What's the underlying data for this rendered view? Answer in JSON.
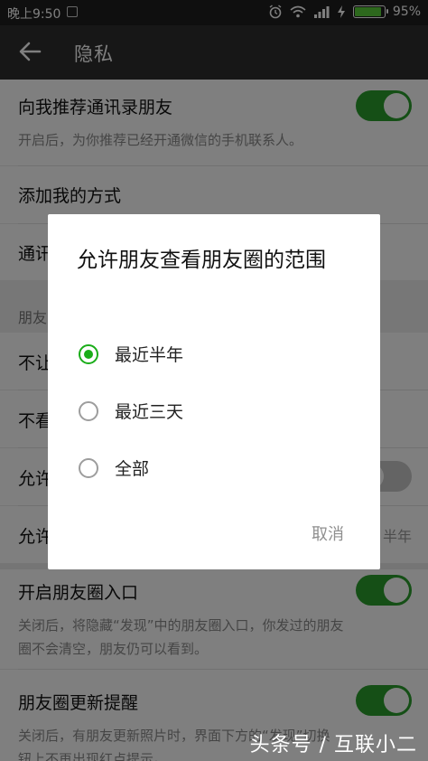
{
  "status_bar": {
    "time": "晚上9:50",
    "battery": "95%",
    "battery_level": 0.95
  },
  "header": {
    "title": "隐私",
    "back_icon": "back-arrow-icon"
  },
  "settings": {
    "recommend_contacts": {
      "label": "向我推荐通讯录朋友",
      "desc": "开启后，为你推荐已经开通微信的手机联系人。",
      "toggle_on": true
    },
    "add_me_methods": {
      "label": "添加我的方式"
    },
    "contacts_partial": {
      "label": "通讯"
    },
    "moments_section": {
      "label": "朋友"
    },
    "no_let_partial": {
      "label": "不让"
    },
    "no_see_partial": {
      "label": "不看"
    },
    "allow_partial_1": {
      "label": "允许",
      "toggle_on": false
    },
    "allow_partial_2": {
      "label": "允许",
      "value": "半年"
    },
    "moments_entry": {
      "label": "开启朋友圈入口",
      "desc_line1": "关闭后，将隐藏“发现”中的朋友圈入口，你发过的朋友",
      "desc_line2": "圈不会清空，朋友仍可以看到。",
      "toggle_on": true
    },
    "moments_update": {
      "label": "朋友圈更新提醒",
      "desc_line1": "关闭后，有朋友更新照片时，界面下方的“发现”切换",
      "desc_line2": "钮上不再出现红点提示。",
      "toggle_on": true
    }
  },
  "dialog": {
    "title": "允许朋友查看朋友圈的范围",
    "options": [
      {
        "label": "最近半年",
        "checked": true
      },
      {
        "label": "最近三天",
        "checked": false
      },
      {
        "label": "全部",
        "checked": false
      }
    ],
    "cancel_label": "取消"
  },
  "watermark": "头条号 / 互联小二",
  "colors": {
    "accent_green": "#1aad19",
    "toggle_green": "#2b9f2d",
    "title_bar": "#2e2e2e"
  }
}
